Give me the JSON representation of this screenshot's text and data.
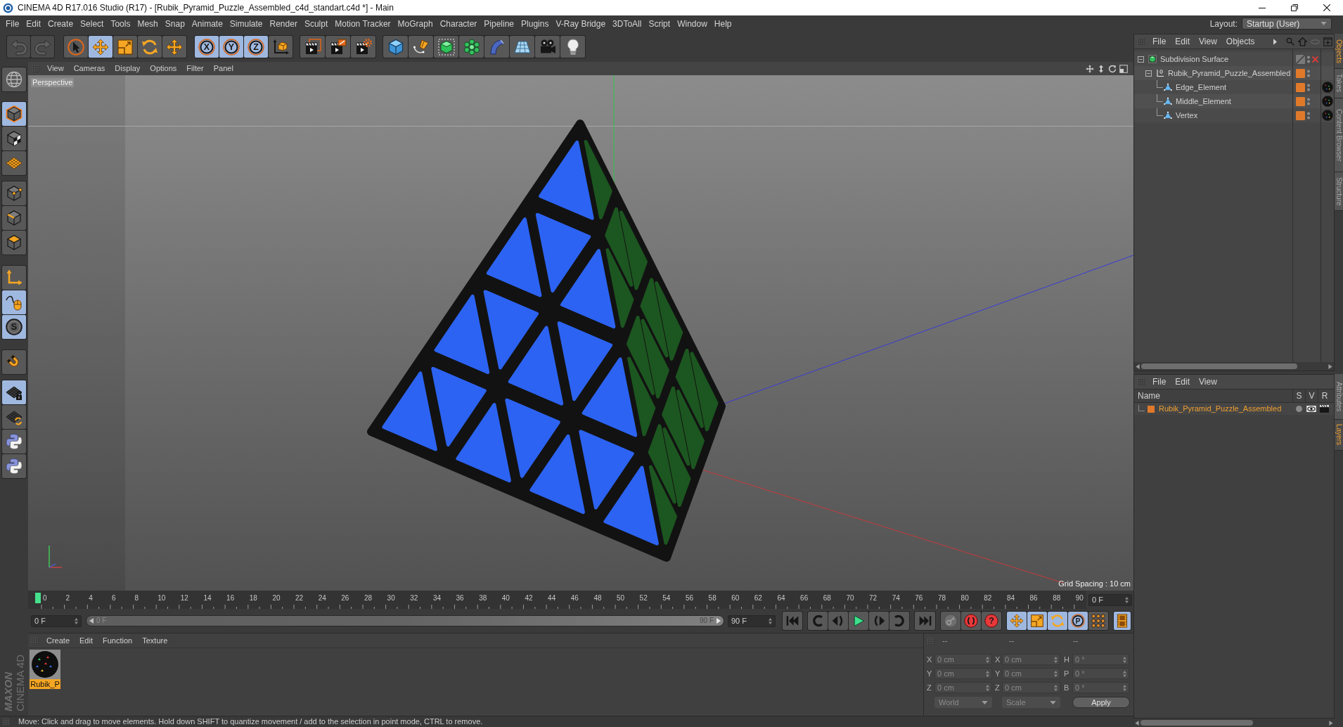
{
  "window": {
    "title": "CINEMA 4D R17.016 Studio (R17) - [Rubik_Pyramid_Puzzle_Assembled_c4d_standart.c4d *] - Main"
  },
  "menu_bar": {
    "items": [
      "File",
      "Edit",
      "Create",
      "Select",
      "Tools",
      "Mesh",
      "Snap",
      "Animate",
      "Simulate",
      "Render",
      "Sculpt",
      "Motion Tracker",
      "MoGraph",
      "Character",
      "Pipeline",
      "Plugins",
      "V-Ray Bridge",
      "3DToAll",
      "Script",
      "Window",
      "Help"
    ],
    "layout_label": "Layout:",
    "layout_value": "Startup (User)"
  },
  "toolbar": {
    "groups": [
      [
        {
          "kind": "undo",
          "selected": false,
          "disabled": true
        },
        {
          "kind": "redo",
          "selected": false,
          "disabled": true
        }
      ],
      [
        {
          "kind": "select",
          "selected": false,
          "disabled": false
        },
        {
          "kind": "move",
          "selected": true,
          "disabled": false
        },
        {
          "kind": "scale",
          "selected": false,
          "disabled": false
        },
        {
          "kind": "rotate",
          "selected": false,
          "disabled": false
        },
        {
          "kind": "move",
          "selected": false,
          "disabled": false
        }
      ],
      [
        {
          "kind": "axis",
          "label": "X",
          "selected": true,
          "disabled": false
        },
        {
          "kind": "axis",
          "label": "Y",
          "selected": true,
          "disabled": false
        },
        {
          "kind": "axis",
          "label": "Z",
          "selected": true,
          "disabled": false
        },
        {
          "kind": "coordinates",
          "selected": false,
          "disabled": false
        }
      ],
      [
        {
          "kind": "render_view",
          "selected": false,
          "disabled": false
        },
        {
          "kind": "render_picture",
          "selected": false,
          "disabled": false
        },
        {
          "kind": "render_settings",
          "selected": false,
          "disabled": false
        }
      ],
      [
        {
          "kind": "cube",
          "selected": false,
          "disabled": false
        },
        {
          "kind": "pen",
          "selected": false,
          "disabled": false
        },
        {
          "kind": "subdivision",
          "selected": false,
          "disabled": false
        },
        {
          "kind": "cloner",
          "selected": false,
          "disabled": false
        },
        {
          "kind": "bend",
          "selected": false,
          "disabled": false
        },
        {
          "kind": "floor",
          "selected": false,
          "disabled": false
        },
        {
          "kind": "camera",
          "selected": false,
          "disabled": false
        },
        {
          "kind": "light",
          "selected": false,
          "disabled": false
        }
      ]
    ]
  },
  "tool_palette": {
    "groups": [
      [
        {
          "kind": "make_editable",
          "selected": false
        }
      ],
      [
        {
          "kind": "model",
          "selected": true
        },
        {
          "kind": "texture",
          "selected": false
        },
        {
          "kind": "workplane",
          "selected": false
        }
      ],
      [
        {
          "kind": "points",
          "selected": false
        },
        {
          "kind": "edges",
          "selected": false
        },
        {
          "kind": "polygons",
          "selected": false
        }
      ],
      [
        {
          "kind": "axis_mode",
          "selected": false
        },
        {
          "kind": "tweak",
          "selected": true
        },
        {
          "kind": "solo",
          "label": "S",
          "selected": true
        }
      ],
      [
        {
          "kind": "magnet",
          "selected": false
        }
      ],
      [
        {
          "kind": "workplane_lock",
          "selected": true
        },
        {
          "kind": "workplane_sync",
          "selected": false
        },
        {
          "kind": "python",
          "selected": false
        },
        {
          "kind": "python",
          "selected": false
        }
      ]
    ]
  },
  "logo": {
    "brand": "MAXON",
    "product": "CINEMA 4D"
  },
  "viewport": {
    "menu": [
      "View",
      "Cameras",
      "Display",
      "Options",
      "Filter",
      "Panel"
    ],
    "camera": "Perspective",
    "grid_spacing": "Grid Spacing : 10 cm"
  },
  "timeline": {
    "frames": [
      "0",
      "2",
      "4",
      "6",
      "8",
      "10",
      "12",
      "14",
      "16",
      "18",
      "20",
      "22",
      "24",
      "26",
      "28",
      "30",
      "32",
      "34",
      "36",
      "38",
      "40",
      "42",
      "44",
      "46",
      "48",
      "50",
      "52",
      "54",
      "56",
      "58",
      "60",
      "62",
      "64",
      "66",
      "68",
      "70",
      "72",
      "74",
      "76",
      "78",
      "80",
      "82",
      "84",
      "86",
      "88",
      "90"
    ],
    "current_frame": "0 F",
    "start_field": "0 F",
    "preview_range": {
      "start": "0 F",
      "end": "90 F"
    },
    "end_field": "90 F"
  },
  "playback": {
    "groups": [
      [
        {
          "kind": "first",
          "selected": false
        }
      ],
      [
        {
          "kind": "previous_key",
          "selected": false
        },
        {
          "kind": "step_back",
          "selected": false
        },
        {
          "kind": "play",
          "selected": false
        },
        {
          "kind": "step_forward",
          "selected": false
        },
        {
          "kind": "next_key",
          "selected": false
        }
      ],
      [
        {
          "kind": "last",
          "selected": false
        }
      ],
      [
        {
          "kind": "key",
          "selected": false
        },
        {
          "kind": "record",
          "selected": false
        },
        {
          "kind": "autokey",
          "label": "?",
          "selected": false
        }
      ],
      [
        {
          "kind": "move",
          "selected": true
        },
        {
          "kind": "scale",
          "selected": true
        },
        {
          "kind": "rotate",
          "selected": true
        },
        {
          "kind": "parameter",
          "label": "P",
          "selected": true
        },
        {
          "kind": "point_level",
          "selected": false
        }
      ],
      [
        {
          "kind": "timeline",
          "selected": true
        }
      ]
    ]
  },
  "material_manager": {
    "menu": [
      "Create",
      "Edit",
      "Function",
      "Texture"
    ],
    "materials": [
      {
        "name": "Rubik_P",
        "selected": true
      }
    ]
  },
  "coordinates": {
    "columns": [
      "--",
      "--",
      "--"
    ],
    "rows": [
      {
        "position_axis": "X",
        "position": "0 cm",
        "size_axis": "X",
        "size": "0 cm",
        "rotation_axis": "H",
        "rotation": "0 °"
      },
      {
        "position_axis": "Y",
        "position": "0 cm",
        "size_axis": "Y",
        "size": "0 cm",
        "rotation_axis": "P",
        "rotation": "0 °"
      },
      {
        "position_axis": "Z",
        "position": "0 cm",
        "size_axis": "Z",
        "size": "0 cm",
        "rotation_axis": "B",
        "rotation": "0 °"
      }
    ],
    "position_mode": "World",
    "size_mode": "Scale",
    "apply": "Apply"
  },
  "status_bar": {
    "text": "Move: Click and drag to move elements. Hold down SHIFT to quantize movement / add to the selection in point mode, CTRL to remove."
  },
  "object_manager": {
    "menu": [
      "File",
      "Edit",
      "View",
      "Objects"
    ],
    "objects": [
      {
        "name": "Subdivision Surface",
        "kind": "subdivision",
        "expanded": true,
        "enabled": false,
        "layer": false,
        "material_tag": false,
        "children": [
          {
            "name": "Rubik_Pyramid_Puzzle_Assembled",
            "kind": "null",
            "expanded": true,
            "layer": true,
            "material_tag": false,
            "children": [
              {
                "name": "Edge_Element",
                "kind": "polygon",
                "layer": true,
                "material_tag": true
              },
              {
                "name": "Middle_Element",
                "kind": "polygon",
                "layer": true,
                "material_tag": true
              },
              {
                "name": "Vertex",
                "kind": "polygon",
                "layer": true,
                "material_tag": true
              }
            ]
          }
        ]
      }
    ]
  },
  "layer_manager": {
    "menu": [
      "File",
      "Edit",
      "View"
    ],
    "columns": [
      "Name",
      "S",
      "V",
      "R"
    ],
    "layers": [
      {
        "name": "Rubik_Pyramid_Puzzle_Assembled"
      }
    ]
  },
  "side_tabs": {
    "upper": [
      {
        "label": "Objects",
        "selected": true
      },
      {
        "label": "Takes",
        "selected": false
      },
      {
        "label": "Content Browser",
        "selected": false
      },
      {
        "label": "Structure",
        "selected": false
      }
    ],
    "lower": [
      {
        "label": "Attributes",
        "selected": false
      },
      {
        "label": "Layers",
        "selected": true
      }
    ]
  }
}
